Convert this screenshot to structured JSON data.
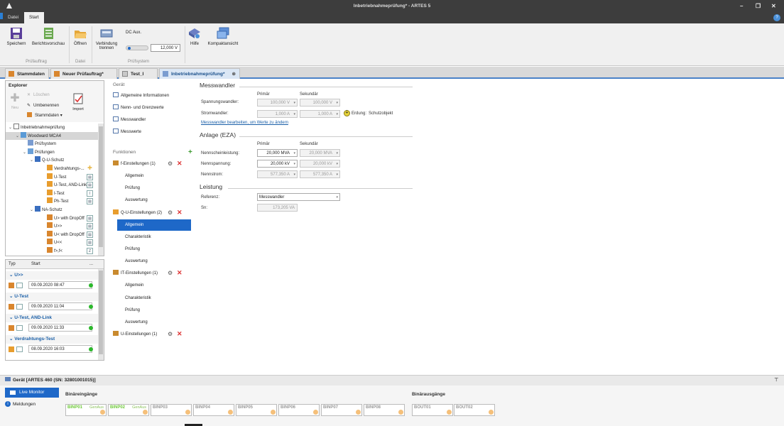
{
  "window": {
    "title": "Inbetriebnahmeprüfung* - ARTES 5",
    "controls": [
      "–",
      "❐",
      "✕"
    ]
  },
  "menu": {
    "tabs": [
      "Datei",
      "Start"
    ],
    "help_label": "?"
  },
  "ribbon": {
    "buttons": {
      "save": "Speichern",
      "report_preview": "Berichtsvorschau",
      "open": "Öffnen",
      "disconnect": "Verbindung trennen",
      "help": "Hilfe",
      "compact_view": "Kompaktansicht"
    },
    "dc_aux": {
      "label": "DC Aux.",
      "value": "12,000 V"
    },
    "groups": [
      "Prüfauftrag",
      "Datei",
      "Prüfsystem"
    ]
  },
  "doc_tabs": [
    {
      "label": "Stammdaten",
      "active": false
    },
    {
      "label": "Neuer Prüfauftrag*",
      "active": false
    },
    {
      "label": "Test_I",
      "active": false
    },
    {
      "label": "Inbetriebnahmeprüfung*",
      "active": true
    }
  ],
  "explorer": {
    "title": "Explorer",
    "tools": {
      "new": "Neu",
      "delete": "Löschen",
      "rename": "Umbenennen",
      "master_data": "Stammdaten",
      "import": "Import"
    },
    "tree": [
      {
        "label": "Inbetriebnahmeprüfung",
        "level": 0,
        "icon": "doc-icon"
      },
      {
        "label": "Woodward MCA4",
        "level": 1,
        "icon": "device-icon",
        "selected": true
      },
      {
        "label": "Prüfsystem",
        "level": 2,
        "icon": "system-icon"
      },
      {
        "label": "Prüfungen",
        "level": 2,
        "icon": "folder-icon"
      },
      {
        "label": "Q-U-Schutz",
        "level": 3,
        "icon": "protection-icon"
      },
      {
        "label": "Verdrahtungs-...",
        "level": 4,
        "icon": "warning-icon"
      },
      {
        "label": "U-Test",
        "level": 4,
        "icon": "shield-icon"
      },
      {
        "label": "U-Test, AND-Link",
        "level": 4,
        "icon": "shield-icon"
      },
      {
        "label": "I-Test",
        "level": 4,
        "icon": "shield-icon"
      },
      {
        "label": "Ph-Test",
        "level": 4,
        "icon": "shield-icon"
      },
      {
        "label": "NA-Schutz",
        "level": 3,
        "icon": "protection-icon"
      },
      {
        "label": "U> with DropOff",
        "level": 4,
        "icon": "bars-icon"
      },
      {
        "label": "U>>",
        "level": 4,
        "icon": "bars-icon"
      },
      {
        "label": "U< with DropOff",
        "level": 4,
        "icon": "bars-icon"
      },
      {
        "label": "U<<",
        "level": 4,
        "icon": "bars-icon"
      },
      {
        "label": "f>,f<",
        "level": 4,
        "icon": "bars-icon"
      }
    ]
  },
  "runs": {
    "columns": [
      "Typ",
      "Start",
      "..."
    ],
    "groups": [
      {
        "name": "U>>",
        "date": "09.09.2020 08:47"
      },
      {
        "name": "U-Test",
        "date": "09.09.2020 11:04"
      },
      {
        "name": "U-Test, AND-Link",
        "date": "09.09.2020 11:33"
      },
      {
        "name": "Verdrahtungs-Test",
        "date": "08.09.2020 16:03"
      }
    ]
  },
  "nav": {
    "device_section": "Gerät",
    "device_items": [
      "Allgemeine Informationen",
      "Nenn- und Grenzwerte",
      "Messwandler",
      "Messwerte"
    ],
    "functions_section": "Funktionen",
    "functions": [
      {
        "label": "f-Einstellungen (1)",
        "subs": [
          "Allgemein",
          "Prüfung",
          "Auswertung"
        ]
      },
      {
        "label": "Q-U-Einstellungen (2)",
        "subs": [
          "Allgemein",
          "Charakteristik",
          "Prüfung",
          "Auswertung"
        ]
      },
      {
        "label": "IT-Einstellungen (1)",
        "subs": [
          "Allgemein",
          "Charakteristik",
          "Prüfung",
          "Auswertung"
        ]
      },
      {
        "label": "U-Einstellungen (1)",
        "subs": []
      }
    ],
    "add_label": "+"
  },
  "content": {
    "messwandler": {
      "title": "Messwandler",
      "col_primary": "Primär",
      "col_secondary": "Sekundär",
      "rows": [
        {
          "label": "Spannungswandler:",
          "primary": "100,000 V",
          "secondary": "100,000 V"
        },
        {
          "label": "Stromwandler:",
          "primary": "1,000 A",
          "secondary": "1,000 A"
        }
      ],
      "earthing_label": "Erdung:",
      "earthing_value": "Schutzobjekt",
      "edit_link": "Messwandler bearbeiten, um Werte zu ändern"
    },
    "anlage": {
      "title": "Anlage (EZA)",
      "col_primary": "Primär",
      "col_secondary": "Sekundär",
      "rows": [
        {
          "label": "Nennscheinleistung:",
          "primary": "20,000 MVA",
          "secondary": "20,000 MVA",
          "active": true
        },
        {
          "label": "Nennspannung:",
          "primary": "20,000 kV",
          "secondary": "20,000 kV",
          "active": true
        },
        {
          "label": "Nennstrom:",
          "primary": "577,350 A",
          "secondary": "577,350 A",
          "active": false
        }
      ]
    },
    "leistung": {
      "title": "Leistung",
      "ref_label": "Referenz:",
      "ref_value": "Messwandler",
      "sn_label": "Sn:",
      "sn_value": "173,205 VA"
    }
  },
  "bottom": {
    "device_label": "Gerät [ARTES 460 (SN: 32801001015)]",
    "live_monitor": "Live Monitor",
    "messages": "Meldungen",
    "binary_inputs_title": "Binäreingänge",
    "binary_outputs_title": "Binärausgänge",
    "inputs": [
      {
        "label": "BINP01",
        "state": "GenAus",
        "on": true
      },
      {
        "label": "BINP02",
        "state": "GenAus",
        "on": true
      },
      {
        "label": "BINP03",
        "state": "",
        "on": false
      },
      {
        "label": "BINP04",
        "state": "",
        "on": false
      },
      {
        "label": "BINP05",
        "state": "",
        "on": false
      },
      {
        "label": "BINP06",
        "state": "",
        "on": false
      },
      {
        "label": "BINP07",
        "state": "",
        "on": false
      },
      {
        "label": "BINP08",
        "state": "",
        "on": false
      }
    ],
    "outputs": [
      {
        "label": "BOUT01",
        "state": "",
        "on": false
      },
      {
        "label": "BOUT02",
        "state": "",
        "on": false
      }
    ]
  }
}
